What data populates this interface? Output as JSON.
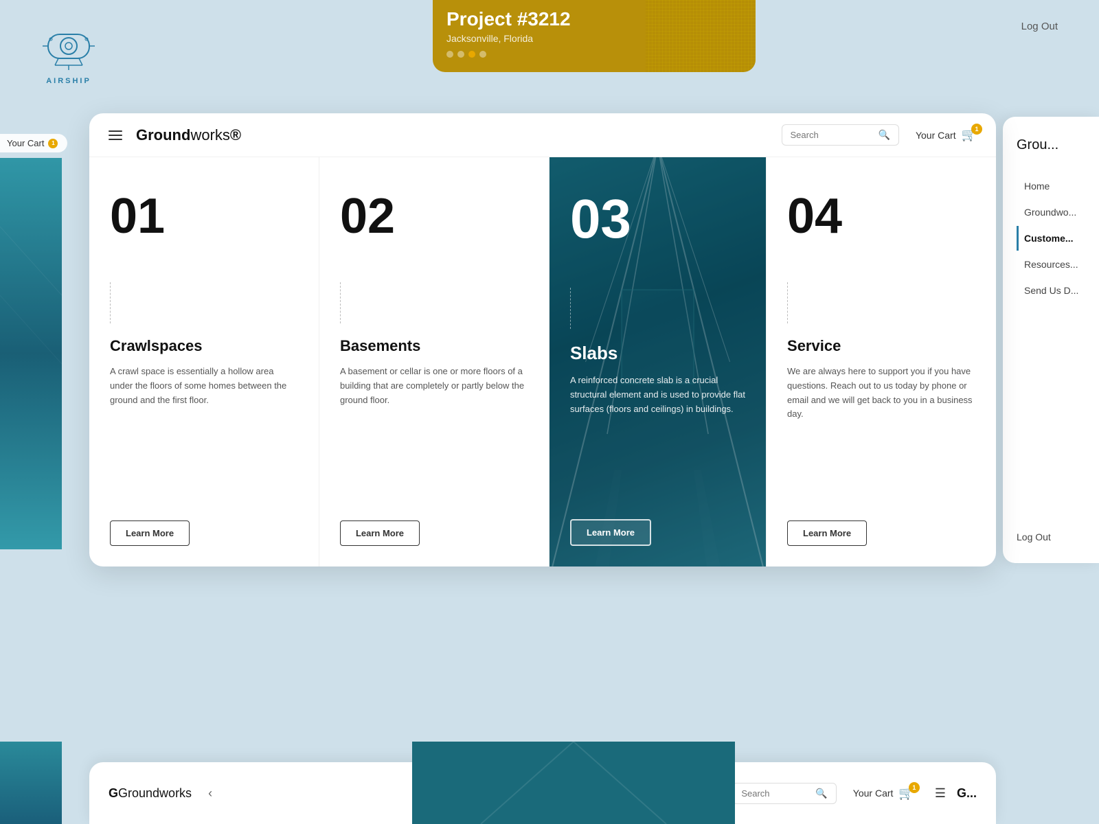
{
  "app": {
    "name": "Airship",
    "logo_text": "AIRSHIP"
  },
  "top_card": {
    "title": "Project #3212",
    "location": "Jacksonville, Florida",
    "dots": [
      {
        "active": false
      },
      {
        "active": false
      },
      {
        "active": true
      },
      {
        "active": false
      }
    ]
  },
  "header": {
    "logo_bold": "Ground",
    "logo_light": "works",
    "logo_symbol": "®",
    "search_placeholder": "Search",
    "cart_label": "Your Cart",
    "cart_count": "1"
  },
  "nav": {
    "logout_top": "Log Out",
    "logout_sidebar": "Log Out"
  },
  "sidebar": {
    "logo": "Grou",
    "items": [
      {
        "label": "Home",
        "active": false
      },
      {
        "label": "Groundwo...",
        "active": false
      },
      {
        "label": "Custome...",
        "active": true
      },
      {
        "label": "Resources...",
        "active": false
      },
      {
        "label": "Send Us D...",
        "active": false
      }
    ]
  },
  "cards": [
    {
      "number": "01",
      "title": "Crawlspaces",
      "description": "A crawl space is essentially a hollow area under the floors of some homes between the ground and the first floor.",
      "button": "Learn More",
      "highlighted": false
    },
    {
      "number": "02",
      "title": "Basements",
      "description": "A basement or cellar is one or more floors of a building that are completely or partly below the ground floor.",
      "button": "Learn More",
      "highlighted": false
    },
    {
      "number": "03",
      "title": "Slabs",
      "description": "A reinforced concrete slab is a crucial structural element and is used to provide flat surfaces (floors and ceilings) in buildings.",
      "button": "Learn More",
      "highlighted": true
    },
    {
      "number": "04",
      "title": "Service",
      "description": "We are always here to support you if you have questions. Reach out to us today by phone or email and we will get back to you in a business day.",
      "button": "Learn More",
      "highlighted": false
    }
  ],
  "bottom_bar": {
    "logo": "Groundworks",
    "cart_label": "Your Cart",
    "cart_count": "1"
  },
  "colors": {
    "accent": "#e8a800",
    "primary": "#2a7fa8",
    "dark": "#111111",
    "teal": "#1a6a7a"
  }
}
